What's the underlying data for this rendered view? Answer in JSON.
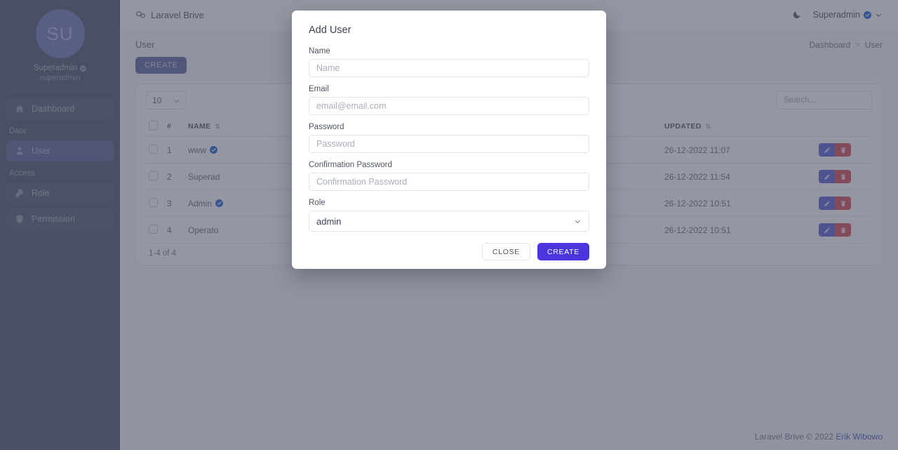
{
  "sidebar": {
    "avatar_initials": "SU",
    "user_name": "Superadmin",
    "user_handle": "superadmin",
    "items": [
      {
        "label": "Dashboard",
        "icon": "home-icon",
        "active": false
      },
      {
        "label": "User",
        "icon": "user-icon",
        "active": true
      },
      {
        "label": "Role",
        "icon": "key-icon",
        "active": false
      },
      {
        "label": "Permission",
        "icon": "shield-icon",
        "active": false
      }
    ],
    "sections": {
      "data": "Data",
      "access": "Access"
    }
  },
  "topbar": {
    "brand": "Laravel Brive",
    "dark_mode_icon": "moon-icon",
    "user_name": "Superadmin",
    "chevron_icon": "chevron-down-icon"
  },
  "page": {
    "title": "User",
    "breadcrumb": {
      "root": "Dashboard",
      "separator": ">",
      "current": "User"
    },
    "create_button": "CREATE"
  },
  "table_tools": {
    "page_length": "10",
    "search_placeholder": "Search..."
  },
  "table": {
    "columns": [
      "#",
      "NAME",
      "UPDATED"
    ],
    "rows": [
      {
        "num": "1",
        "name": "www",
        "verified": true,
        "updated": "26-12-2022 11:07"
      },
      {
        "num": "2",
        "name": "Superad",
        "verified": false,
        "updated": "26-12-2022 11:54"
      },
      {
        "num": "3",
        "name": "Admin",
        "verified": true,
        "updated": "26-12-2022 10:51"
      },
      {
        "num": "4",
        "name": "Operato",
        "verified": false,
        "updated": "26-12-2022 10:51"
      }
    ],
    "footer_info": "1-4 of 4",
    "edit_icon": "pencil-icon",
    "delete_icon": "trash-icon"
  },
  "footer": {
    "text": "Laravel Brive © 2022 ",
    "author": "Erik Wibowo"
  },
  "modal": {
    "title": "Add User",
    "fields": {
      "name": {
        "label": "Name",
        "placeholder": "Name",
        "value": ""
      },
      "email": {
        "label": "Email",
        "placeholder": "email@email.com",
        "value": ""
      },
      "password": {
        "label": "Password",
        "placeholder": "Password",
        "value": ""
      },
      "confirmation": {
        "label": "Confirmation Password",
        "placeholder": "Confirmation Password",
        "value": ""
      },
      "role": {
        "label": "Role",
        "selected": "admin"
      }
    },
    "close_label": "CLOSE",
    "create_label": "CREATE"
  },
  "colors": {
    "sidebar_bg": "#5b6073",
    "sidebar_active": "#6a6e9e",
    "avatar_bg": "#7d80bd",
    "primary": "#4a35de",
    "edit_btn": "#6366d8",
    "delete_btn": "#d8565f",
    "overlay": "#8e929f"
  }
}
